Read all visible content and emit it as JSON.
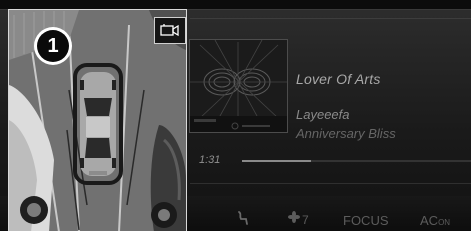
{
  "callout": {
    "number": "1"
  },
  "camera": {
    "toggle_icon": "camera-icon"
  },
  "media": {
    "title": "Lover Of Arts",
    "artist": "Layeeefa",
    "album": "Anniversary Bliss",
    "elapsed": "1:31",
    "progress_fraction": 0.3
  },
  "climate": {
    "seat_icon": "seat-heating-icon",
    "fan_icon": "fan-icon",
    "fan_level": "7",
    "focus_label": "FOCUS",
    "ac_label": "AC",
    "ac_state": "ON"
  }
}
